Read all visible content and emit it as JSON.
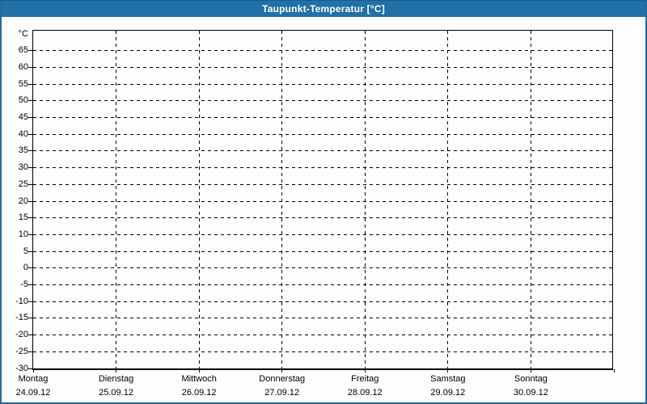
{
  "window": {
    "title": "Taupunkt-Temperatur [°C]"
  },
  "colors": {
    "titlebar": "#2170a7",
    "window_border": "#25689b",
    "background": "#fcfdfc",
    "grid": "#000000",
    "axis": "#000000",
    "title_text": "#ffffff"
  },
  "chart_data": {
    "type": "line",
    "title": "Taupunkt-Temperatur [°C]",
    "xlabel": "",
    "ylabel": "°C",
    "ylim": [
      -30,
      71
    ],
    "yticks": [
      65,
      60,
      55,
      50,
      45,
      40,
      35,
      30,
      25,
      20,
      15,
      10,
      5,
      0,
      -5,
      -10,
      -15,
      -20,
      -25,
      -30
    ],
    "categories": [
      "Montag",
      "Dienstag",
      "Mittwoch",
      "Donnerstag",
      "Freitag",
      "Samstag",
      "Sonntag"
    ],
    "dates": [
      "24.09.12",
      "25.09.12",
      "26.09.12",
      "27.09.12",
      "28.09.12",
      "29.09.12",
      "30.09.12"
    ],
    "series": [],
    "grid": "dashed",
    "legend": "none"
  }
}
